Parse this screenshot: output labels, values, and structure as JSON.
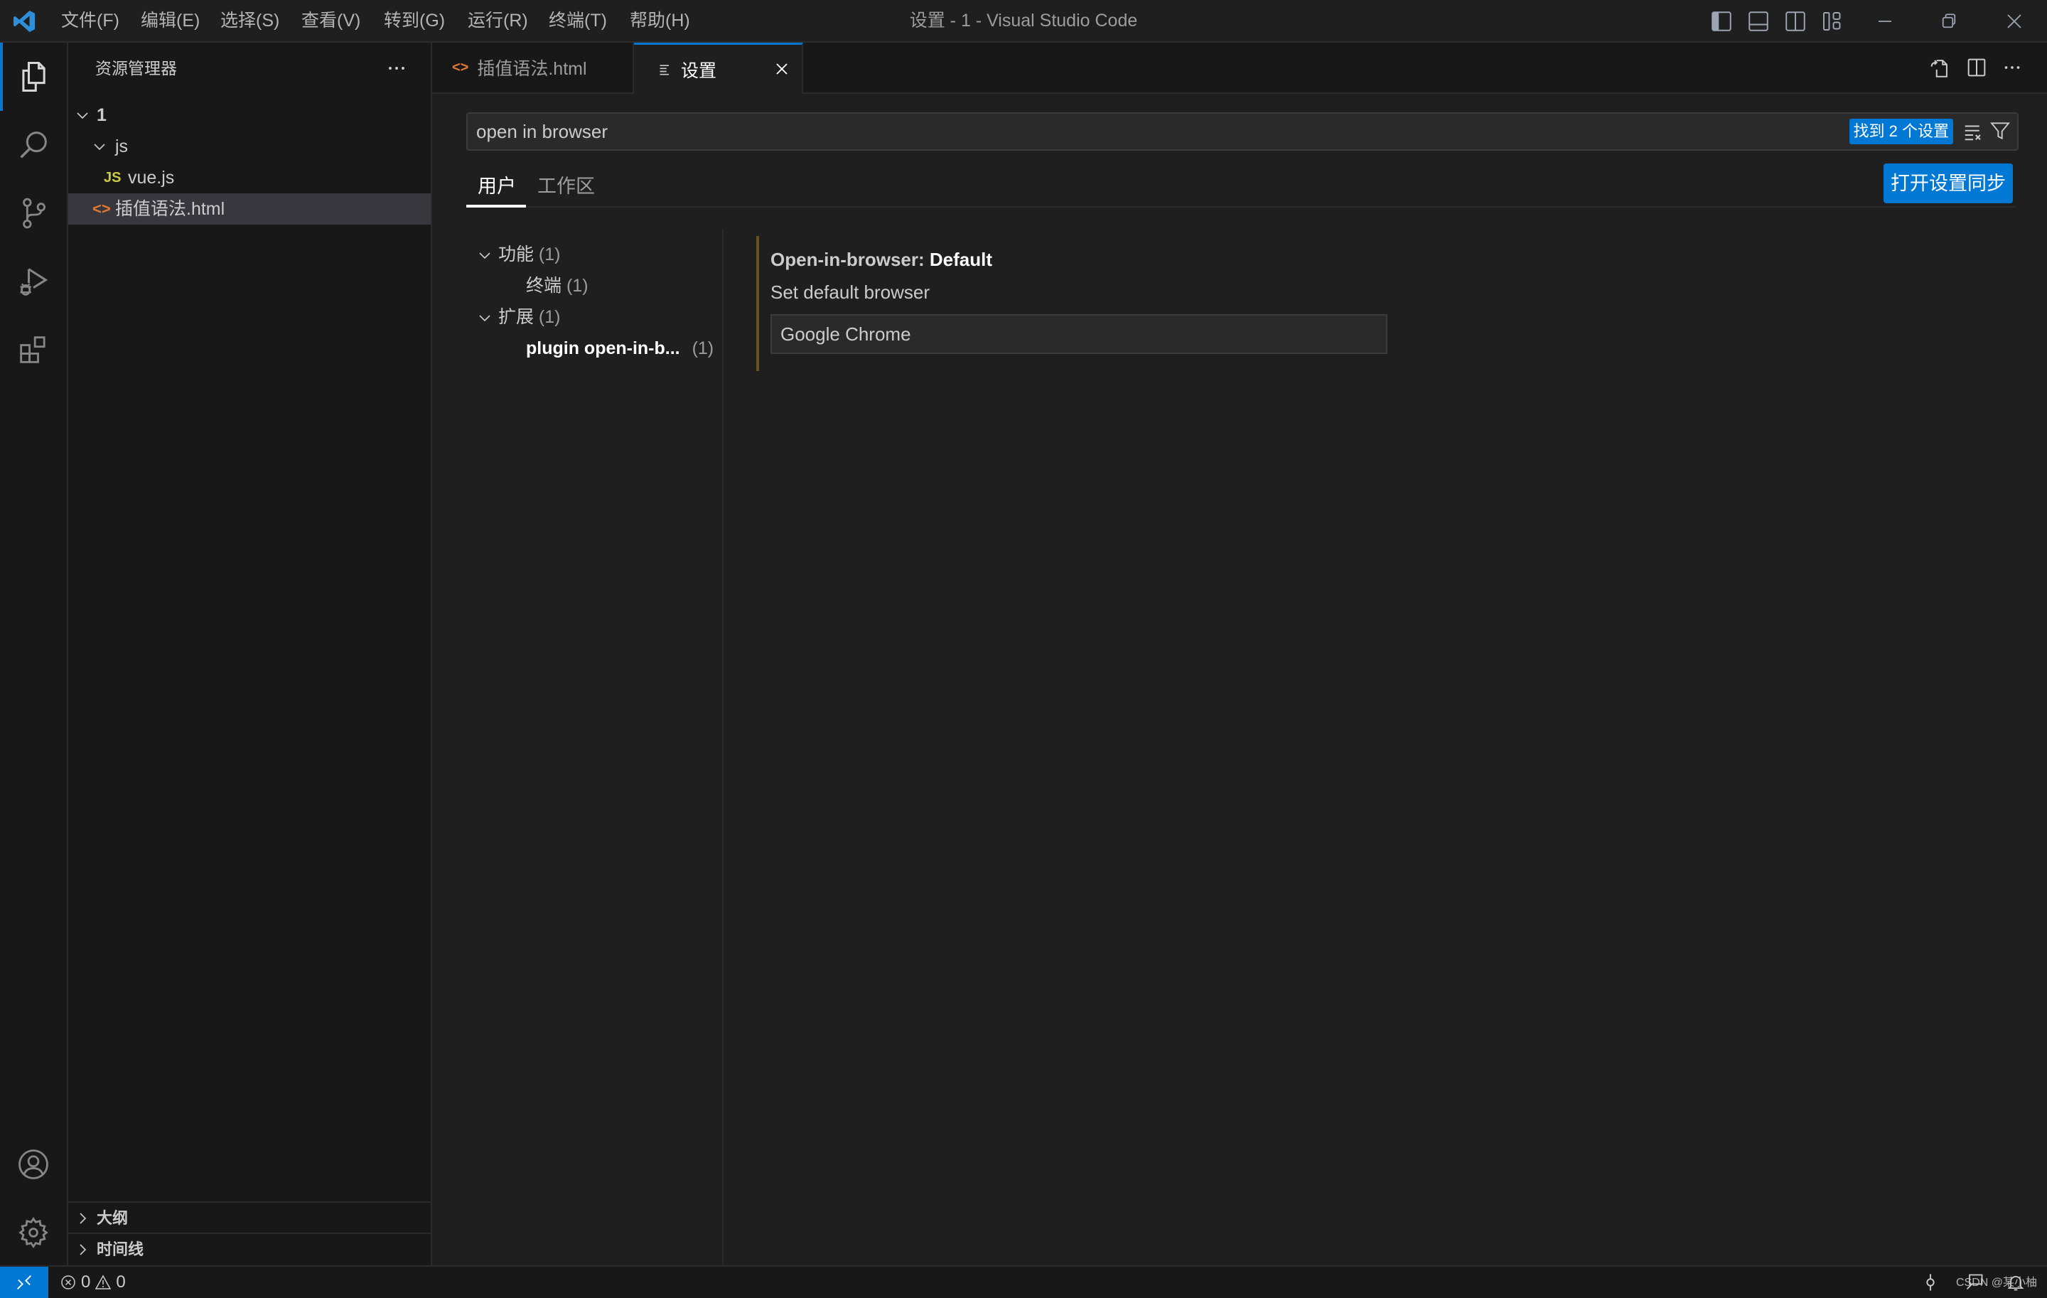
{
  "window": {
    "title": "设置 - 1 - Visual Studio Code",
    "menu": [
      "文件(F)",
      "编辑(E)",
      "选择(S)",
      "查看(V)",
      "转到(G)",
      "运行(R)",
      "终端(T)",
      "帮助(H)"
    ],
    "layout_icons": [
      "toggle-primary-sidebar-icon",
      "toggle-panel-icon",
      "toggle-secondary-sidebar-icon",
      "customize-layout-icon"
    ],
    "controls": [
      "minimize-icon",
      "restore-icon",
      "close-icon"
    ]
  },
  "activity_bar": {
    "top": [
      "explorer-icon",
      "search-icon",
      "source-control-icon",
      "run-debug-icon",
      "extensions-icon"
    ],
    "bottom": [
      "accounts-icon",
      "manage-gear-icon"
    ],
    "active": "explorer-icon"
  },
  "sidebar": {
    "title": "资源管理器",
    "tree": [
      {
        "label": "1",
        "type": "folder",
        "expanded": true,
        "depth": 0
      },
      {
        "label": "js",
        "type": "folder",
        "expanded": true,
        "depth": 1
      },
      {
        "label": "vue.js",
        "type": "js-file",
        "badge": "JS",
        "depth": 2
      },
      {
        "label": "插值语法.html",
        "type": "html-file",
        "depth": 1,
        "selected": true
      }
    ],
    "sections": [
      "大纲",
      "时间线"
    ]
  },
  "tabs": [
    {
      "label": "插值语法.html",
      "icon": "html-file-icon",
      "active": false
    },
    {
      "label": "设置",
      "icon": "settings-list-icon",
      "active": true
    }
  ],
  "settings": {
    "search_value": "open in browser",
    "found_badge": "找到 2 个设置",
    "scopes": [
      "用户",
      "工作区"
    ],
    "active_scope": "用户",
    "sync_button": "打开设置同步",
    "toc": [
      {
        "label": "功能",
        "count": "(1)",
        "expanded": true,
        "depth": 0
      },
      {
        "label": "终端",
        "count": "(1)",
        "depth": 1
      },
      {
        "label": "扩展",
        "count": "(1)",
        "expanded": true,
        "depth": 0
      },
      {
        "label": "plugin open-in-b...",
        "count": "(1)",
        "depth": 1,
        "bold": true
      }
    ],
    "item": {
      "category": "Open-in-browser: ",
      "key": "Default",
      "description": "Set default browser",
      "value": "Google Chrome"
    }
  },
  "statusbar": {
    "errors": "0",
    "warnings": "0",
    "watermark": "CSDN @某小柚"
  },
  "colors": {
    "accent": "#0078d4",
    "html_icon": "#e37933",
    "js_icon": "#cbcb41",
    "modified_bar": "#6a5220"
  }
}
